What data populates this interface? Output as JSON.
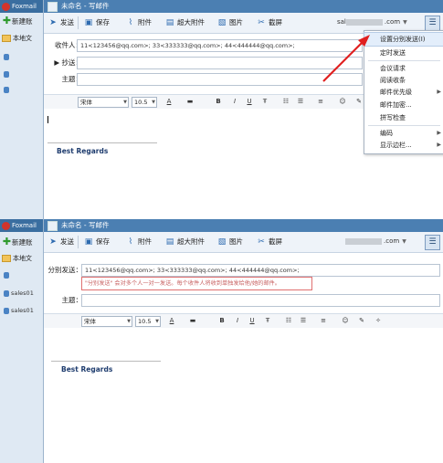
{
  "app": {
    "brand": "Foxmail",
    "window_title": "未命名 - 写邮件",
    "new_button": "新建账",
    "local_folder": "本地文",
    "accounts": [
      "sales01",
      "sales01"
    ]
  },
  "toolbar": {
    "send": "发送",
    "save": "保存",
    "attach": "附件",
    "big_attach": "超大附件",
    "picture": "图片",
    "screenshot": "截屏",
    "account_suffix_1": "sal",
    "account_suffix": ".com"
  },
  "compose1": {
    "to_label": "收件人：",
    "to_value": "11<123456@qq.com>; 33<333333@qq.com>; 44<444444@qq.com>;",
    "cc_label": "抄送：",
    "subject_label": "主题："
  },
  "compose2": {
    "to_label": "分别发送：",
    "to_value": "11<123456@qq.com>; 33<333333@qq.com>; 44<444444@qq.com>;",
    "subject_label": "主题：",
    "notice": "\"分别发送\" 会对多个人一对一发送。每个收件人将收到单独发给他/她的邮件。"
  },
  "format": {
    "font": "宋体",
    "size": "10.5",
    "size2": "10.5"
  },
  "body": {
    "signature": "Best Regards"
  },
  "menu": {
    "items": [
      {
        "label": "设置分别发送(I)",
        "highlighted": true
      },
      {
        "label": "定时发送"
      },
      {
        "label": "会议请求"
      },
      {
        "label": "阅读收条"
      },
      {
        "label": "邮件优先级",
        "submenu": true
      },
      {
        "label": "邮件加密..."
      },
      {
        "label": "拼写检查"
      },
      {
        "label": "编码",
        "submenu": true
      },
      {
        "label": "显示边栏...",
        "submenu": true
      }
    ]
  },
  "colors": {
    "accent": "#4b7fb2",
    "arrow": "#e02020",
    "notice_border": "#e07070",
    "signature": "#1e3c6e"
  },
  "icons": {
    "send": "paper-plane-icon",
    "save": "floppy-icon",
    "attach": "paperclip-icon",
    "big_attach": "big-attachment-icon",
    "picture": "picture-icon",
    "screenshot": "scissors-icon",
    "menu": "hamburger-menu-icon"
  }
}
